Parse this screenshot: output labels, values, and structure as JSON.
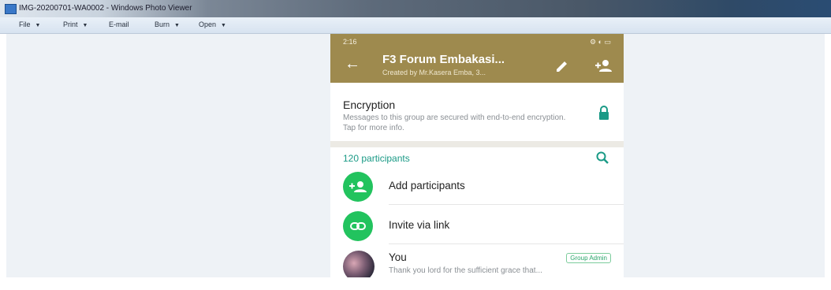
{
  "window": {
    "title": "IMG-20200701-WA0002 - Windows Photo Viewer",
    "menu": [
      {
        "label": "File",
        "has_caret": true
      },
      {
        "label": "Print",
        "has_caret": true
      },
      {
        "label": "E-mail",
        "has_caret": false
      },
      {
        "label": "Burn",
        "has_caret": true
      },
      {
        "label": "Open",
        "has_caret": true
      }
    ]
  },
  "phone": {
    "status": {
      "time": "2:16",
      "right": "⚙ ◐ ▭"
    },
    "header": {
      "title": "F3 Forum Embakasi...",
      "subtitle": "Created by Mr.Kasera Emba, 3...",
      "color": "#9e8a4e"
    },
    "encryption": {
      "title": "Encryption",
      "description": "Messages to this group are secured with end-to-end encryption. Tap for more info."
    },
    "participants": {
      "count_label": "120 participants",
      "add_label": "Add participants",
      "invite_label": "Invite via link",
      "you": {
        "name": "You",
        "message": "Thank you lord for the sufficient grace that...",
        "badge": "Group Admin"
      }
    },
    "accent": "#22c35e"
  }
}
